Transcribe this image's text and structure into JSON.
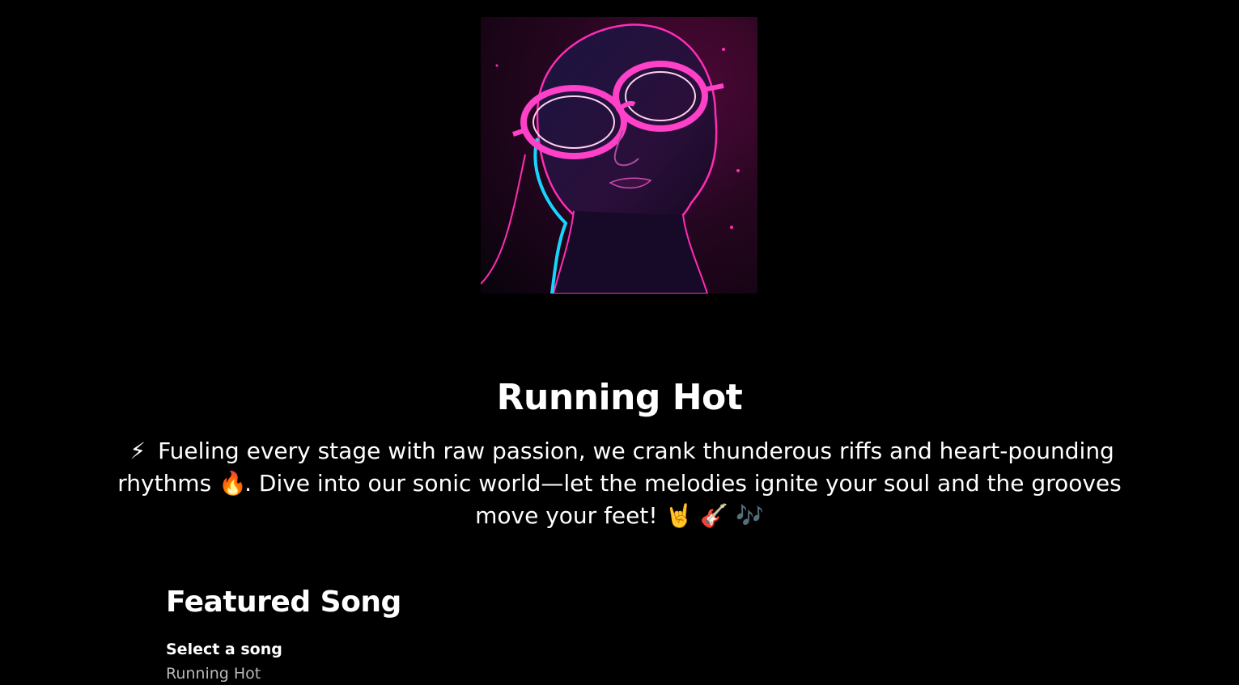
{
  "artist": {
    "name": "Running Hot",
    "bio": {
      "line1_icon": "⚡",
      "line1_text": "Fueling every stage with raw passion, we crank thunderous riffs and heart-pounding rhythms",
      "fire_icon": "🔥",
      "line2_text": ". Dive into our sonic world—let the melodies ignite your soul and the grooves move your feet!",
      "end_icons": "🤘 🎸 🎶"
    }
  },
  "featured": {
    "heading": "Featured Song",
    "select_label": "Select a song",
    "selected_song": "Running Hot"
  },
  "colors": {
    "background": "#000000",
    "text": "#ffffff",
    "muted": "#b9b9b9",
    "neon_pink": "#ff1aa8",
    "neon_cyan": "#19d4ff"
  }
}
